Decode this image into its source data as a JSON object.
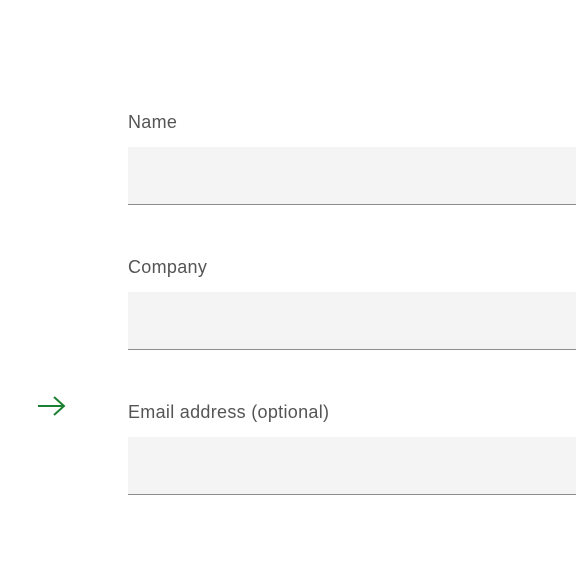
{
  "form": {
    "fields": [
      {
        "label": "Name",
        "value": ""
      },
      {
        "label": "Company",
        "value": ""
      },
      {
        "label": "Email address (optional)",
        "value": ""
      }
    ]
  }
}
